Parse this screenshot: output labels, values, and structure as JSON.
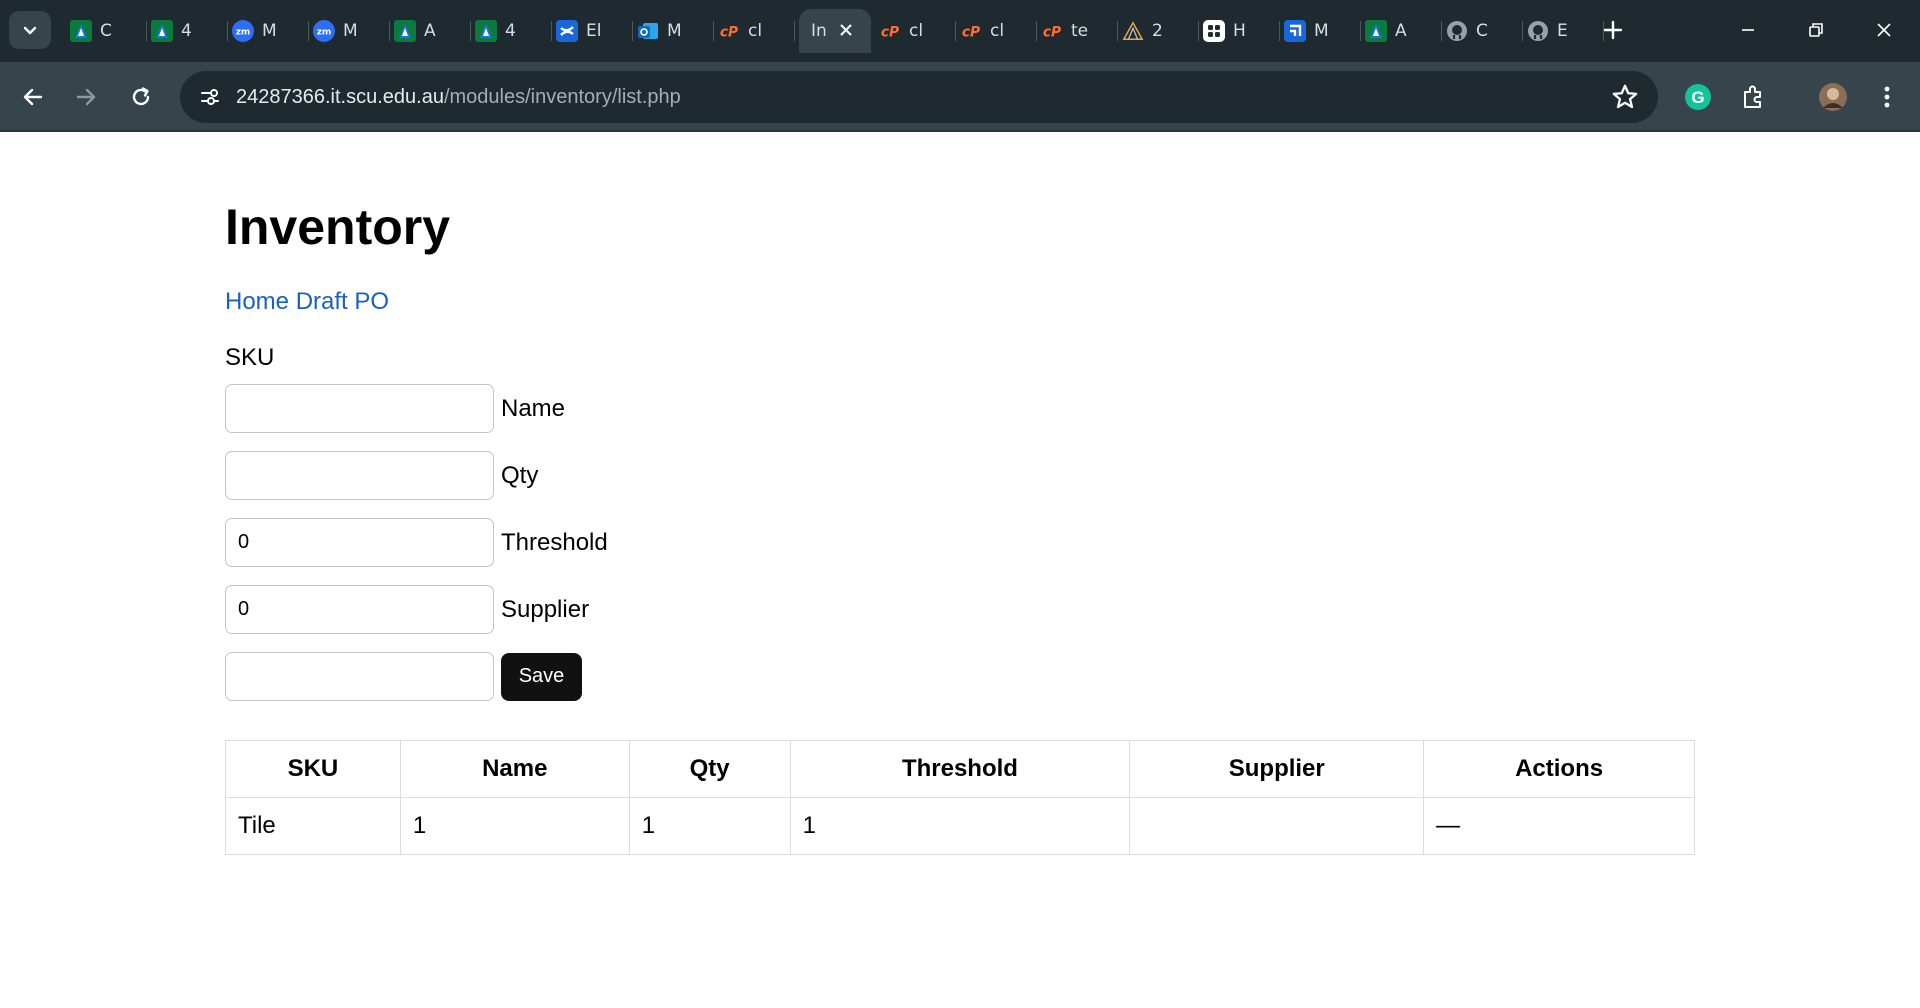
{
  "browser": {
    "tabs": [
      {
        "label": "C",
        "favicon": "atlassian-icon",
        "color": "#1a73e8"
      },
      {
        "label": "4",
        "favicon": "atlassian-icon",
        "color": "#1a73e8"
      },
      {
        "label": "M",
        "favicon": "zoom-icon",
        "color": "#2d6ef5"
      },
      {
        "label": "M",
        "favicon": "zoom-icon",
        "color": "#2d6ef5"
      },
      {
        "label": "A",
        "favicon": "atlassian-icon",
        "color": "#1a73e8"
      },
      {
        "label": "4",
        "favicon": "atlassian-icon",
        "color": "#1a73e8"
      },
      {
        "label": "El",
        "favicon": "confluence-icon",
        "color": "#1868db"
      },
      {
        "label": "M",
        "favicon": "outlook-icon",
        "color": "#0f6cbd"
      },
      {
        "label": "cl",
        "favicon": "cpanel-icon",
        "color": "#ff6c2c"
      },
      {
        "label": "In",
        "favicon": "none",
        "color": "#36444c",
        "active": true
      },
      {
        "label": "cl",
        "favicon": "cpanel-icon",
        "color": "#ff6c2c"
      },
      {
        "label": "cl",
        "favicon": "cpanel-icon",
        "color": "#ff6c2c"
      },
      {
        "label": "te",
        "favicon": "cpanel-icon",
        "color": "#ff6c2c"
      },
      {
        "label": "2",
        "favicon": "tent-icon",
        "color": "#e8a640"
      },
      {
        "label": "H",
        "favicon": "grid-app-icon",
        "color": "#ffffff"
      },
      {
        "label": "M",
        "favicon": "jira-icon",
        "color": "#1868db"
      },
      {
        "label": "A",
        "favicon": "atlassian-icon",
        "color": "#1a73e8"
      },
      {
        "label": "C",
        "favicon": "github-icon",
        "color": "#9aa0a6"
      },
      {
        "label": "E",
        "favicon": "github-icon",
        "color": "#9aa0a6"
      }
    ],
    "url_host": "24287366.it.scu.edu.au",
    "url_path": "/modules/inventory/list.php"
  },
  "page": {
    "title": "Inventory",
    "nav_home": "Home",
    "nav_draft": "Draft PO",
    "form": {
      "sku_label": "SKU",
      "name_label": "Name",
      "qty_label": "Qty",
      "threshold_label": "Threshold",
      "supplier_label": "Supplier",
      "sku_value": "",
      "name_value": "",
      "qty_value": "0",
      "threshold_value": "0",
      "supplier_value": "",
      "save_label": "Save"
    },
    "table": {
      "headers": [
        "SKU",
        "Name",
        "Qty",
        "Threshold",
        "Supplier",
        "Actions"
      ],
      "rows": [
        [
          "Tile",
          "1",
          "1",
          "1",
          "",
          "—"
        ]
      ]
    }
  }
}
